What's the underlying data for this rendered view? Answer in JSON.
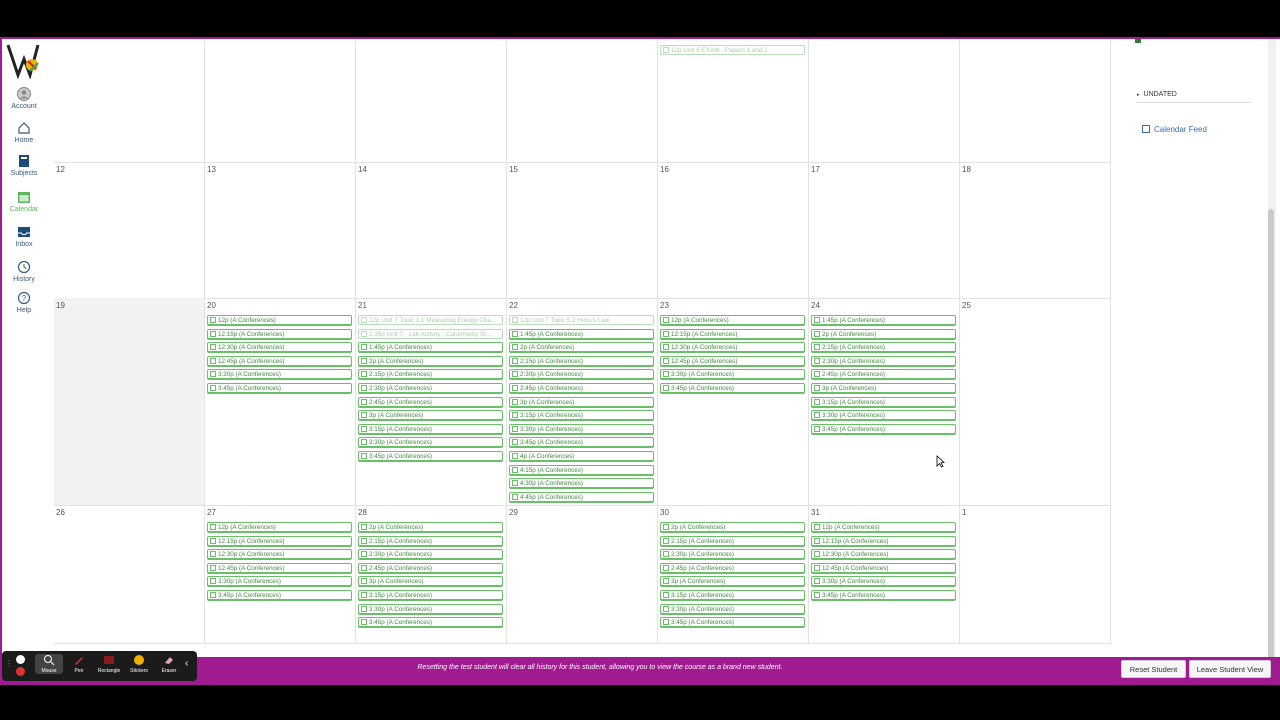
{
  "nav": {
    "items": [
      {
        "label": "Account"
      },
      {
        "label": "Home"
      },
      {
        "label": "Subjects"
      },
      {
        "label": "Calendar"
      },
      {
        "label": "Inbox"
      },
      {
        "label": "History"
      },
      {
        "label": "Help"
      }
    ]
  },
  "calendar": {
    "rows": [
      {
        "days": [
          {
            "num": "",
            "events": []
          },
          {
            "num": "",
            "events": []
          },
          {
            "num": "",
            "events": []
          },
          {
            "num": "",
            "events": []
          },
          {
            "num": "",
            "events": [
              {
                "time": "12p",
                "title": "Unit 6 EXAM - Papers 1 and 2",
                "faded": true
              }
            ]
          },
          {
            "num": "",
            "events": []
          },
          {
            "num": "",
            "events": []
          }
        ]
      },
      {
        "days": [
          {
            "num": "12",
            "events": []
          },
          {
            "num": "13",
            "events": []
          },
          {
            "num": "14",
            "events": []
          },
          {
            "num": "15",
            "events": []
          },
          {
            "num": "16",
            "events": []
          },
          {
            "num": "17",
            "events": []
          },
          {
            "num": "18",
            "events": []
          }
        ]
      },
      {
        "days": [
          {
            "num": "19",
            "events": []
          },
          {
            "num": "20",
            "events": [
              {
                "time": "12p",
                "title": "(A Conferences)"
              },
              {
                "time": "12:15p",
                "title": "(A Conferences)"
              },
              {
                "time": "12:30p",
                "title": "(A Conferences)"
              },
              {
                "time": "12:45p",
                "title": "(A Conferences)"
              },
              {
                "time": "3:30p",
                "title": "(A Conferences)"
              },
              {
                "time": "3:45p",
                "title": "(A Conferences)"
              }
            ]
          },
          {
            "num": "21",
            "events": [
              {
                "time": "12p",
                "title": "Unit 7 Topic 3.1 Measuring Energy Cha...",
                "faded": true
              },
              {
                "time": "1:35p",
                "title": "Unit 7 - Lab Activity - Calorimetry St...",
                "faded": true
              },
              {
                "time": "1:45p",
                "title": "(A Conferences)"
              },
              {
                "time": "2p",
                "title": "(A Conferences)"
              },
              {
                "time": "2:15p",
                "title": "(A Conferences)"
              },
              {
                "time": "2:30p",
                "title": "(A Conferences)"
              },
              {
                "time": "2:45p",
                "title": "(A Conferences)"
              },
              {
                "time": "3p",
                "title": "(A Conferences)"
              },
              {
                "time": "3:15p",
                "title": "(A Conferences)"
              },
              {
                "time": "3:30p",
                "title": "(A Conferences)"
              },
              {
                "time": "3:45p",
                "title": "(A Conferences)"
              }
            ]
          },
          {
            "num": "22",
            "events": [
              {
                "time": "12p",
                "title": "Unit 7 Topic 5.2 Hess's Law",
                "faded": true
              },
              {
                "time": "1:45p",
                "title": "(A Conferences)"
              },
              {
                "time": "2p",
                "title": "(A Conferences)"
              },
              {
                "time": "2:15p",
                "title": "(A Conferences)"
              },
              {
                "time": "2:30p",
                "title": "(A Conferences)"
              },
              {
                "time": "2:45p",
                "title": "(A Conferences)"
              },
              {
                "time": "3p",
                "title": "(A Conferences)"
              },
              {
                "time": "3:15p",
                "title": "(A Conferences)"
              },
              {
                "time": "3:30p",
                "title": "(A Conferences)"
              },
              {
                "time": "3:45p",
                "title": "(A Conferences)"
              },
              {
                "time": "4p",
                "title": "(A Conferences)"
              },
              {
                "time": "4:15p",
                "title": "(A Conferences)"
              },
              {
                "time": "4:30p",
                "title": "(A Conferences)"
              },
              {
                "time": "4:45p",
                "title": "(A Conferences)"
              }
            ]
          },
          {
            "num": "23",
            "events": [
              {
                "time": "12p",
                "title": "(A Conferences)"
              },
              {
                "time": "12:15p",
                "title": "(A Conferences)"
              },
              {
                "time": "12:30p",
                "title": "(A Conferences)"
              },
              {
                "time": "12:45p",
                "title": "(A Conferences)"
              },
              {
                "time": "3:30p",
                "title": "(A Conferences)"
              },
              {
                "time": "3:45p",
                "title": "(A Conferences)"
              }
            ]
          },
          {
            "num": "24",
            "events": [
              {
                "time": "1:45p",
                "title": "(A Conferences)"
              },
              {
                "time": "2p",
                "title": "(A Conferences)"
              },
              {
                "time": "2:15p",
                "title": "(A Conferences)"
              },
              {
                "time": "2:30p",
                "title": "(A Conferences)"
              },
              {
                "time": "2:45p",
                "title": "(A Conferences)"
              },
              {
                "time": "3p",
                "title": "(A Conferences)"
              },
              {
                "time": "3:15p",
                "title": "(A Conferences)"
              },
              {
                "time": "3:30p",
                "title": "(A Conferences)"
              },
              {
                "time": "3:45p",
                "title": "(A Conferences)"
              }
            ]
          },
          {
            "num": "25",
            "events": []
          }
        ]
      },
      {
        "days": [
          {
            "num": "26",
            "events": []
          },
          {
            "num": "27",
            "events": [
              {
                "time": "12p",
                "title": "(A Conferences)"
              },
              {
                "time": "12:15p",
                "title": "(A Conferences)"
              },
              {
                "time": "12:30p",
                "title": "(A Conferences)"
              },
              {
                "time": "12:45p",
                "title": "(A Conferences)"
              },
              {
                "time": "3:30p",
                "title": "(A Conferences)"
              },
              {
                "time": "3:45p",
                "title": "(A Conferences)"
              }
            ]
          },
          {
            "num": "28",
            "events": [
              {
                "time": "2p",
                "title": "(A Conferences)"
              },
              {
                "time": "2:15p",
                "title": "(A Conferences)"
              },
              {
                "time": "2:30p",
                "title": "(A Conferences)"
              },
              {
                "time": "2:45p",
                "title": "(A Conferences)"
              },
              {
                "time": "3p",
                "title": "(A Conferences)"
              },
              {
                "time": "3:15p",
                "title": "(A Conferences)"
              },
              {
                "time": "3:30p",
                "title": "(A Conferences)"
              },
              {
                "time": "3:45p",
                "title": "(A Conferences)"
              }
            ]
          },
          {
            "num": "29",
            "events": []
          },
          {
            "num": "30",
            "events": [
              {
                "time": "2p",
                "title": "(A Conferences)"
              },
              {
                "time": "2:15p",
                "title": "(A Conferences)"
              },
              {
                "time": "2:30p",
                "title": "(A Conferences)"
              },
              {
                "time": "2:45p",
                "title": "(A Conferences)"
              },
              {
                "time": "3p",
                "title": "(A Conferences)"
              },
              {
                "time": "3:15p",
                "title": "(A Conferences)"
              },
              {
                "time": "3:30p",
                "title": "(A Conferences)"
              },
              {
                "time": "3:45p",
                "title": "(A Conferences)"
              }
            ]
          },
          {
            "num": "31",
            "events": [
              {
                "time": "12p",
                "title": "(A Conferences)"
              },
              {
                "time": "12:15p",
                "title": "(A Conferences)"
              },
              {
                "time": "12:30p",
                "title": "(A Conferences)"
              },
              {
                "time": "12:45p",
                "title": "(A Conferences)"
              },
              {
                "time": "3:30p",
                "title": "(A Conferences)"
              },
              {
                "time": "3:45p",
                "title": "(A Conferences)"
              }
            ]
          },
          {
            "num": "1",
            "events": []
          }
        ]
      }
    ]
  },
  "sidebar": {
    "undated_label": "UNDATED",
    "feed_label": "Calendar Feed"
  },
  "student_view": {
    "message": "Resetting the test student will clear all history for this student, allowing you to view the course as a brand new student.",
    "reset_label": "Reset Student",
    "leave_label": "Leave Student View"
  },
  "tools": [
    {
      "label": "Mouse",
      "icon": "mouse-icon"
    },
    {
      "label": "Pen",
      "icon": "pen-icon"
    },
    {
      "label": "Rectangle",
      "icon": "rectangle-icon"
    },
    {
      "label": "Stickers",
      "icon": "sticker-icon"
    },
    {
      "label": "Eraser",
      "icon": "eraser-icon"
    }
  ],
  "colors": {
    "accent": "#a01b8f",
    "event_green": "#5cb85c"
  }
}
